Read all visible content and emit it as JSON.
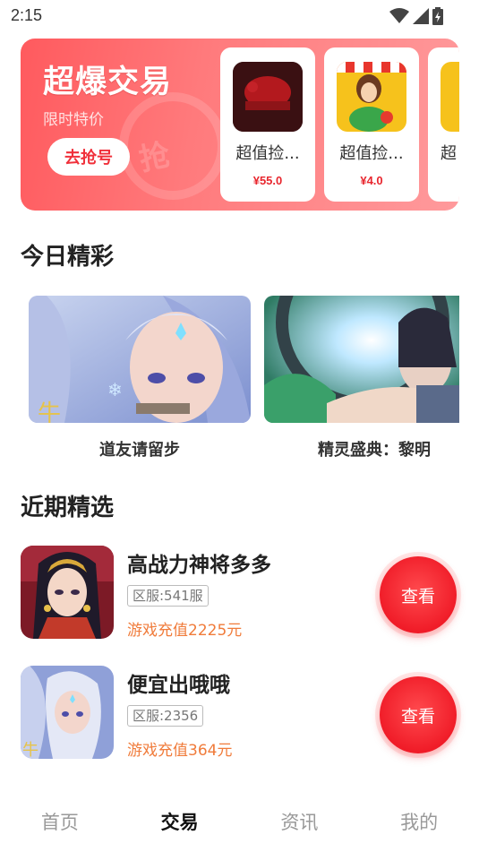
{
  "status_bar": {
    "time": "2:15"
  },
  "banner": {
    "title": "超爆交易",
    "subtitle": "限时特价",
    "button_label": "去抢号",
    "deals": [
      {
        "name": "超值捡...",
        "price": "¥55.0"
      },
      {
        "name": "超值捡...",
        "price": "¥4.0"
      },
      {
        "name": "超",
        "price": ""
      }
    ]
  },
  "today": {
    "title": "今日精彩",
    "items": [
      {
        "caption": "道友请留步"
      },
      {
        "caption": "精灵盛典：黎明"
      }
    ]
  },
  "recent": {
    "title": "近期精选",
    "items": [
      {
        "title": "高战力神将多多",
        "server": "区服:541服",
        "price": "游戏充值2225元",
        "button": "查看"
      },
      {
        "title": "便宜出哦哦",
        "server": "区服:2356",
        "price": "游戏充值364元",
        "button": "查看"
      }
    ]
  },
  "nav": {
    "items": [
      {
        "label": "首页"
      },
      {
        "label": "交易"
      },
      {
        "label": "资讯"
      },
      {
        "label": "我的"
      }
    ],
    "active_index": 1
  },
  "colors": {
    "accent": "#f01c28",
    "price_orange": "#f07b3a",
    "banner_gradient_start": "#ff5a5e"
  }
}
